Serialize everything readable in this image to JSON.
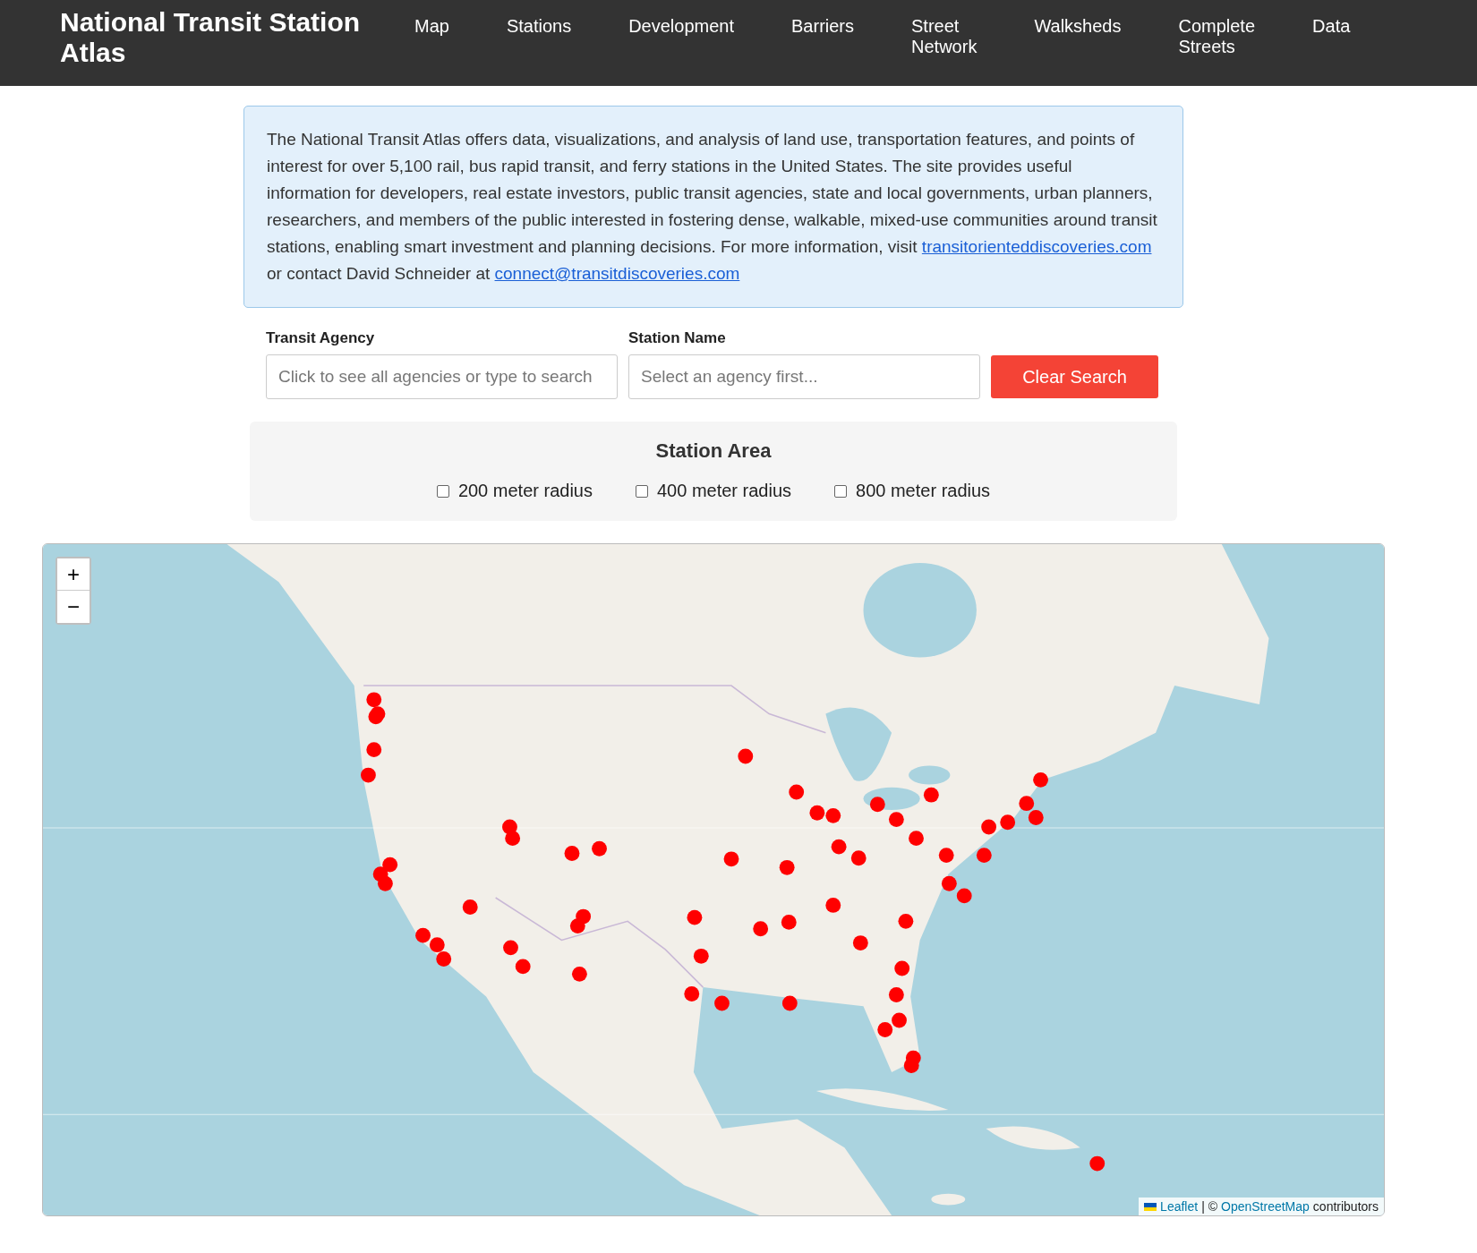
{
  "header": {
    "title": "National Transit Station Atlas",
    "nav": [
      {
        "label": "Map"
      },
      {
        "label": "Stations"
      },
      {
        "label": "Development"
      },
      {
        "label": "Barriers"
      },
      {
        "label": "Street Network"
      },
      {
        "label": "Walksheds"
      },
      {
        "label": "Complete Streets"
      },
      {
        "label": "Data"
      }
    ]
  },
  "intro": {
    "parts": [
      {
        "kind": "text",
        "text": "The National Transit Atlas offers data, visualizations, and analysis of land use, transportation features, and points of interest for over 5,100 rail, bus rapid transit, and ferry stations in the United States. The site provides useful information for developers, real estate investors, public transit agencies, state and local governments, urban planners, researchers, and members of the public interested in fostering dense, walkable, mixed-use communities around transit stations, enabling smart investment and planning decisions. For more information, visit "
      },
      {
        "kind": "link",
        "text": "transitorienteddiscoveries.com"
      },
      {
        "kind": "text",
        "text": " or contact David Schneider at "
      },
      {
        "kind": "link",
        "text": "connect@transitdiscoveries.com"
      }
    ]
  },
  "search": {
    "fields": [
      {
        "label": "Transit Agency",
        "placeholder": "Click to see all agencies or type to search"
      },
      {
        "label": "Station Name",
        "placeholder": "Select an agency first..."
      }
    ],
    "clear_button": "Clear Search"
  },
  "station_area": {
    "title": "Station Area",
    "options": [
      {
        "label": "200 meter radius",
        "checked": false
      },
      {
        "label": "400 meter radius",
        "checked": false
      },
      {
        "label": "800 meter radius",
        "checked": false
      }
    ]
  },
  "map": {
    "kind": "picture",
    "zoom_controls": [
      "+",
      "−"
    ],
    "attribution": [
      {
        "kind": "link",
        "text": "Leaflet"
      },
      {
        "kind": "text",
        "text": "| ©"
      },
      {
        "kind": "link",
        "text": "OpenStreetMap"
      },
      {
        "kind": "text",
        "text": "contributors"
      }
    ]
  }
}
